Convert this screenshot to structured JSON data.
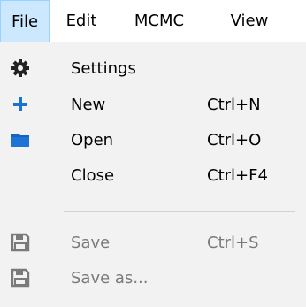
{
  "menubar": {
    "items": [
      {
        "label": "File",
        "active": true
      },
      {
        "label": "Edit"
      },
      {
        "label": "MCMC"
      },
      {
        "label": "View"
      }
    ]
  },
  "file_menu": {
    "settings": {
      "label": "Settings",
      "icon": "gear-icon"
    },
    "new": {
      "mnemonic": "N",
      "label_rest": "ew",
      "shortcut": "Ctrl+N",
      "icon": "plus-icon",
      "icon_color": "#1a73d1"
    },
    "open": {
      "label": "Open",
      "shortcut": "Ctrl+O",
      "icon": "folder-icon",
      "icon_color": "#1565c0"
    },
    "close": {
      "label": "Close",
      "shortcut": "Ctrl+F4"
    },
    "save": {
      "mnemonic": "S",
      "label_rest": "ave",
      "shortcut": "Ctrl+S",
      "icon": "floppy-disk-icon",
      "disabled": true
    },
    "save_as": {
      "label": "Save as...",
      "icon": "floppy-disk-icon",
      "disabled": true
    }
  },
  "colors": {
    "active_menu_bg": "#cce8ff",
    "active_menu_border": "#99d1ff",
    "dropdown_bg": "#f2f2f2",
    "disabled_text": "#7a7a7a"
  }
}
